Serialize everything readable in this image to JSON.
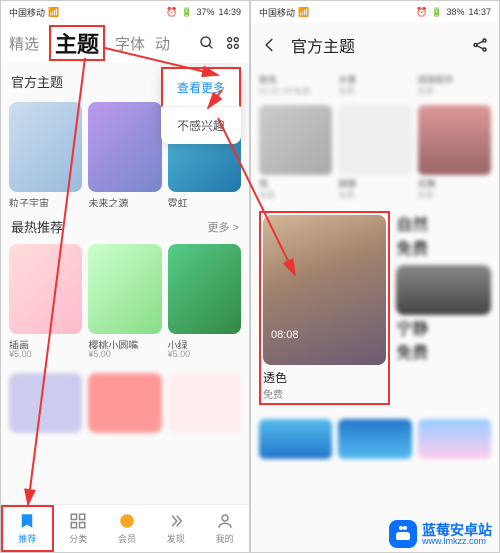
{
  "left": {
    "statusbar": {
      "carrier": "中国移动",
      "battery": "37%",
      "time": "14:39",
      "alarm_icon": "alarm"
    },
    "tabs": {
      "featured": "精选",
      "themes": "主题",
      "fonts": "字体",
      "anim_partial": "动",
      "search_icon": "search",
      "grid_icon": "grid"
    },
    "menu_icon": "more-vertical",
    "sections": {
      "official": {
        "title": "官方主题",
        "items": [
          {
            "label": "粒子宇宙",
            "sub": ""
          },
          {
            "label": "未来之源",
            "sub": ""
          },
          {
            "label": "霓虹",
            "sub": ""
          }
        ]
      },
      "hot": {
        "title": "最热推荐",
        "more": "更多 >",
        "items": [
          {
            "label": "插画",
            "sub": "¥5.00"
          },
          {
            "label": "樱桃小圆嘴",
            "sub": "¥5.00"
          },
          {
            "label": "小绿",
            "sub": "¥5.00"
          }
        ]
      }
    },
    "dropdown": {
      "view_more": "查看更多",
      "not_interested": "不感兴趣"
    },
    "bottomnav": {
      "recommend": "推荐",
      "categories": "分类",
      "member": "会员",
      "discover": "发现",
      "mine": "我的"
    }
  },
  "right": {
    "statusbar": {
      "carrier": "中国移动",
      "battery": "38%",
      "time": "14:37"
    },
    "header": {
      "back_icon": "back",
      "title": "官方主题",
      "share_icon": "share"
    },
    "row1": [
      {
        "label": "致色",
        "sub": "¥3.00 VIP免费"
      },
      {
        "label": "水墨",
        "sub": "免费"
      },
      {
        "label": "绮丽昭华",
        "sub": "免费"
      }
    ],
    "row2": [
      {
        "label": "简",
        "sub": "免费"
      },
      {
        "label": "娴静",
        "sub": "免费"
      },
      {
        "label": "花舞",
        "sub": "免费"
      }
    ],
    "featured": {
      "time_overlay": "08:08",
      "name": "透色",
      "sub": "免费"
    },
    "side": [
      {
        "label": "自然",
        "sub": "免费"
      },
      {
        "label": "宁静",
        "sub": "免费"
      }
    ]
  },
  "watermark": {
    "title": "蓝莓安卓站",
    "url": "www.lmkzz.com"
  }
}
